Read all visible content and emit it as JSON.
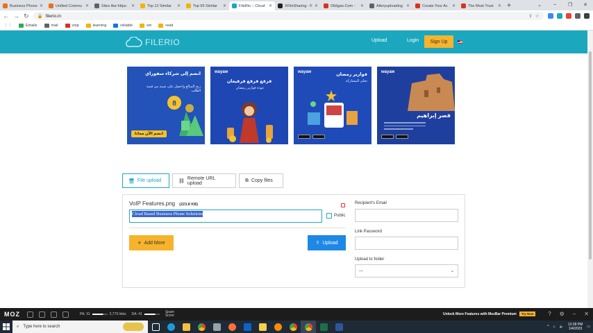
{
  "browser": {
    "tabs": [
      {
        "title": "Business Phone",
        "color": "#e8711a",
        "active": false
      },
      {
        "title": "Unified Commu",
        "color": "#e8711a",
        "active": false
      },
      {
        "title": "Sites like https:",
        "color": "#5f6368",
        "active": false
      },
      {
        "title": "Top 12 Similar",
        "color": "#f4b400",
        "active": false
      },
      {
        "title": "Top 65 Similar",
        "color": "#f4b400",
        "active": false
      },
      {
        "title": "FileRio :: Cloud",
        "color": "#1ba8bf",
        "active": true
      },
      {
        "title": "XFileSharing - F",
        "color": "#222222",
        "active": false
      },
      {
        "title": "Obligao.Com :",
        "color": "#d93025",
        "active": false
      },
      {
        "title": "Alteryuploading",
        "color": "#5f6368",
        "active": false
      },
      {
        "title": "Create Your Ac",
        "color": "#d93025",
        "active": false
      },
      {
        "title": "The Most Trust",
        "color": "#d93025",
        "active": false
      }
    ],
    "new_tab": "+",
    "window_controls": [
      "⌄",
      "–",
      "❐",
      "✕"
    ],
    "url": "filerio.in",
    "bookmarks": [
      {
        "label": "Emails",
        "color": "#34a853"
      },
      {
        "label": "mail",
        "color": "#5f6368"
      },
      {
        "label": "voip",
        "color": "#d93025"
      },
      {
        "label": "learning",
        "color": "#f4b400"
      },
      {
        "label": "reliable",
        "color": "#1a73e8"
      },
      {
        "label": "sm",
        "color": "#f4b400"
      },
      {
        "label": "read",
        "color": "#f4b400"
      }
    ]
  },
  "site": {
    "logo": "FILERIO",
    "nav": {
      "upload": "Upload",
      "login": "Login",
      "signup": "Sign Up"
    },
    "accent": "#1ba8bf"
  },
  "ads": [
    {
      "brand": "",
      "headline": "انضم إلى شركاء سفوراي",
      "sub": "ربح المبالغ واحصل على نسبة من قيمة الطلب",
      "cta": "انضم الآن مجانا",
      "bg": "#2352b8"
    },
    {
      "brand": "wayaw",
      "headline": "قرقع قرقع قرقيعان",
      "sub": "عودة فوازير رمضان",
      "cta": "",
      "bg": "#1f47b3"
    },
    {
      "brand": "wayaw",
      "headline": "فوازير رمضان",
      "sub": "تحلى المشاركة",
      "cta": "",
      "bg": "#1f4bb8"
    },
    {
      "brand": "wayaw",
      "headline": "قصر إبراهيم",
      "sub": "",
      "cta": "",
      "bg": "#1f3f9f"
    }
  ],
  "upload_tabs": {
    "file": "File upload",
    "remote": "Remote URL upload",
    "copy": "Copy files"
  },
  "form": {
    "file_name": "VoIP Features.png",
    "file_size": "(223.8 KB)",
    "description": "Cloud Based Business Phone Solutions",
    "public_label": "Public",
    "add_more": "Add More",
    "upload": "Upload",
    "recipient_label": "Recipient's Email",
    "password_label": "Link Password",
    "folder_label": "Upload to folder",
    "folder_value": "---"
  },
  "moz": {
    "logo": "MOZ",
    "pa": "PA: 31",
    "links": "2,779 links",
    "da": "DA: 41",
    "spam": "Spam Score",
    "promo": "Unlock More Features with MozBar Premium",
    "try": "Try Now"
  },
  "taskbar": {
    "search_placeholder": "Type here to search",
    "time": "12:28 PM",
    "date": "1/4/2023"
  }
}
